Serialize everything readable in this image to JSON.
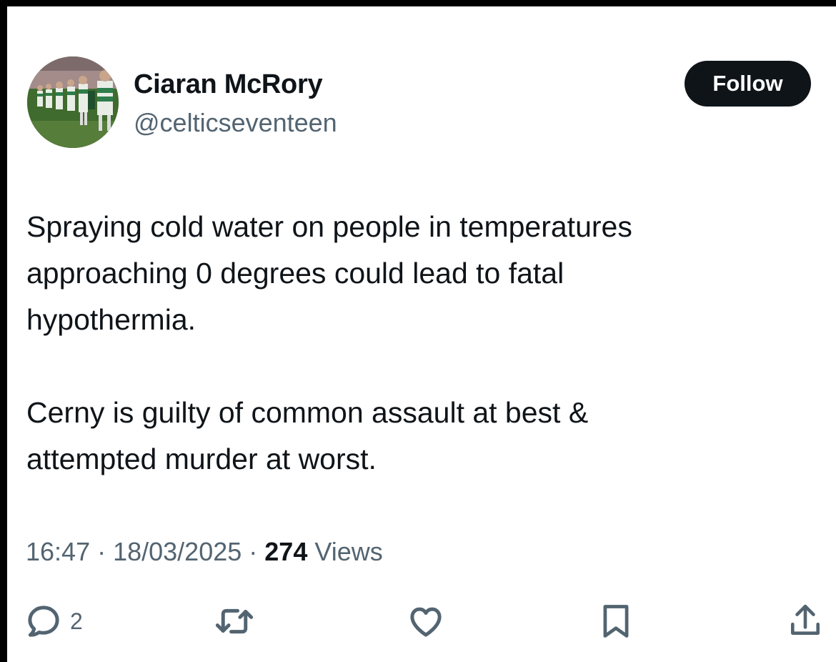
{
  "author": {
    "name": "Ciaran McRory",
    "handle": "@celticseventeen"
  },
  "follow_label": "Follow",
  "tweet": {
    "paragraph1": "Spraying cold water on people in temperatures\napproaching 0 degrees could lead to fatal\nhypothermia.",
    "paragraph2": "Cerny is guilty of common assault at best &\nattempted murder at worst."
  },
  "meta": {
    "time": "16:47",
    "separator": " · ",
    "date": "18/03/2025",
    "views_count": "274",
    "views_label": " Views"
  },
  "actions": {
    "reply_count": "2",
    "icons": [
      "reply-icon",
      "retweet-icon",
      "like-icon",
      "bookmark-icon",
      "share-icon"
    ]
  },
  "colors": {
    "text_primary": "#0f1419",
    "text_secondary": "#536471",
    "follow_bg": "#0f1419",
    "follow_text": "#ffffff"
  }
}
